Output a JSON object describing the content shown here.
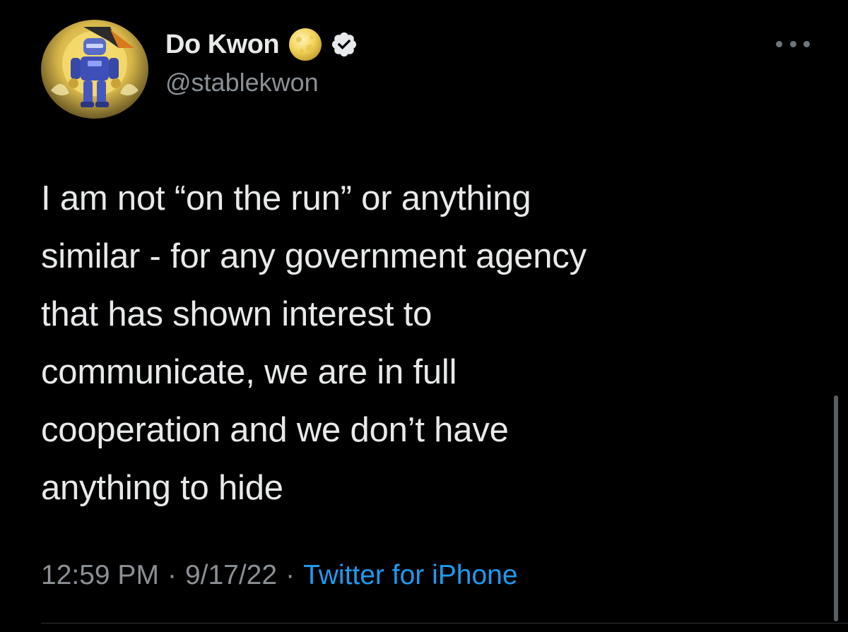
{
  "tweet": {
    "author": {
      "display_name": "Do Kwon",
      "handle": "@stablekwon",
      "verified": true,
      "name_emoji": "full-moon-icon"
    },
    "text": "I am not “on the run” or anything\nsimilar - for any government agency\nthat has shown interest to\ncommunicate, we are in full\ncooperation and we don’t have\nanything to hide",
    "time": "12:59 PM",
    "date": "9/17/22",
    "separator": "·",
    "source": "Twitter for iPhone"
  },
  "colors": {
    "background": "#000000",
    "text_primary": "#e7e9ea",
    "text_secondary": "#8b9095",
    "link": "#1d9bf0"
  }
}
